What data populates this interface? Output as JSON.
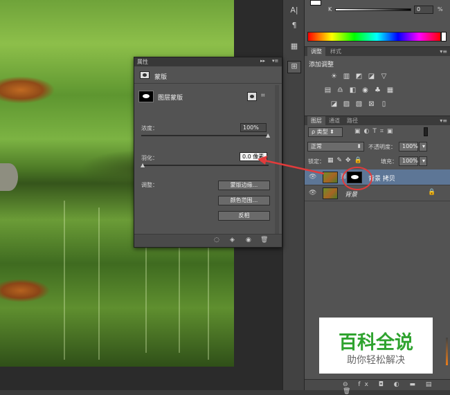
{
  "properties_panel": {
    "title": "属性",
    "collapse_glyph": "▸▸",
    "menu_glyph": "▾≡",
    "section": "蒙版",
    "mask_label": "图层蒙版",
    "density_label": "浓度：",
    "density_value": "100%",
    "density_level": 1.0,
    "feather_label": "羽化：",
    "feather_value": "0.0 像素",
    "feather_level": 0.0,
    "adjust_label": "调整：",
    "btn_mask_edge": "蒙版边缘...",
    "btn_color_range": "颜色范围...",
    "btn_invert": "反相"
  },
  "color_panel": {
    "k_label": "K",
    "k_value": "0",
    "k_unit": "%"
  },
  "adjustments_panel": {
    "tab_adjust": "调整",
    "tab_styles": "样式",
    "add_label": "添加调整"
  },
  "layers_panel": {
    "tab_layers": "图层",
    "tab_channels": "通道",
    "tab_paths": "路径",
    "filter_kind": "ρ 类型",
    "blend_mode": "正常",
    "opacity_label": "不透明度：",
    "opacity_value": "100%",
    "lock_label": "锁定：",
    "fill_label": "填充：",
    "fill_value": "100%",
    "layers": [
      {
        "name": "背景 拷贝"
      },
      {
        "name": "背景"
      }
    ],
    "footer_icons": "⊖ fx ◘ ◐ ▬ ▤ 🗑"
  },
  "tool_strip": {
    "icon_a": "A|",
    "icon_para": "¶"
  },
  "watermark": {
    "title": "百科全说",
    "subtitle": "助你轻松解决"
  },
  "colors": {
    "accent_red": "#e23b3b",
    "watermark_green": "#2fa32f",
    "selected_row": "#5d7696"
  }
}
